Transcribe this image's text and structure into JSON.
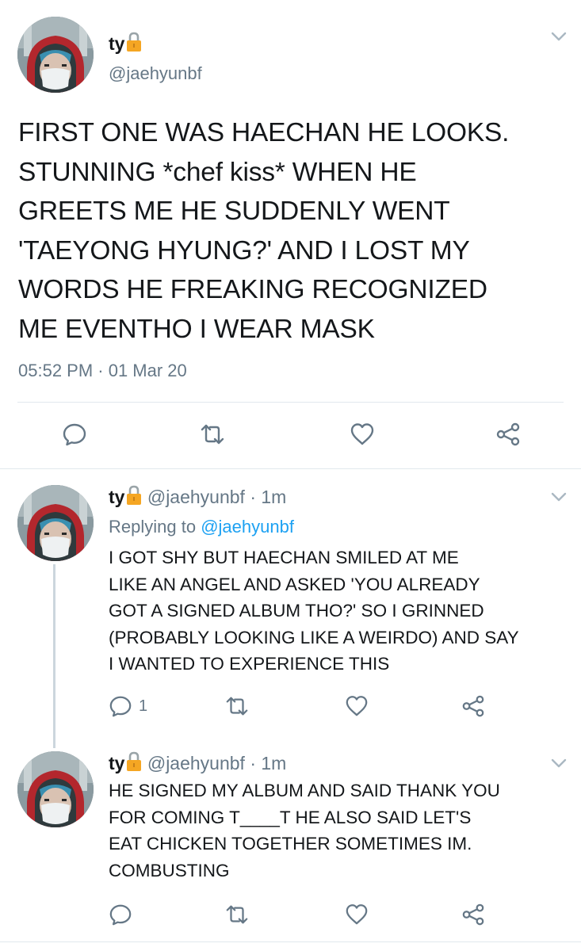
{
  "main_tweet": {
    "display_name": "ty",
    "handle": "@jaehyunbf",
    "text_lines": [
      "FIRST ONE WAS HAECHAN HE LOOKS.",
      "STUNNING *chef kiss* WHEN HE",
      "GREETS ME HE SUDDENLY WENT",
      "'TAEYONG HYUNG?' AND I LOST MY",
      "WORDS HE FREAKING RECOGNIZED",
      "ME EVENTHO I WEAR MASK"
    ],
    "timestamp": "05:52 PM · 01 Mar 20"
  },
  "replies": [
    {
      "display_name": "ty",
      "meta": "@jaehyunbf · 1m",
      "replying_prefix": "Replying to ",
      "replying_to": "@jaehyunbf",
      "text_lines": [
        "I GOT SHY BUT HAECHAN SMILED AT ME",
        "LIKE AN ANGEL AND ASKED 'YOU ALREADY",
        "GOT A SIGNED ALBUM THO?' SO I GRINNED",
        "(PROBABLY LOOKING LIKE A WEIRDO) AND SAY",
        "I WANTED TO EXPERIENCE THIS"
      ],
      "reply_count": "1"
    },
    {
      "display_name": "ty",
      "meta": "@jaehyunbf · 1m",
      "text_lines": [
        "HE SIGNED MY ALBUM AND SAID THANK YOU",
        "FOR COMING T____T HE ALSO SAID LET'S",
        "EAT CHICKEN TOGETHER SOMETIMES  IM.",
        "COMBUSTING"
      ]
    }
  ],
  "icons": {
    "reply": "speech-bubble-icon",
    "retweet": "retweet-icon",
    "like": "heart-icon",
    "share": "share-icon",
    "lock": "lock-icon",
    "more": "chevron-down-icon"
  },
  "colors": {
    "text": "#14171a",
    "secondary": "#657786",
    "link": "#1da1f2",
    "divider": "#e1e8ed",
    "lock": "#f5a623"
  }
}
